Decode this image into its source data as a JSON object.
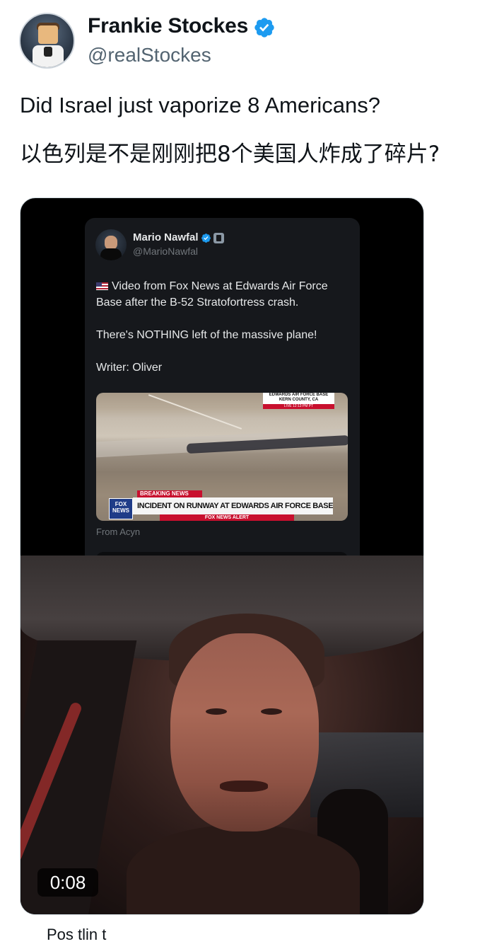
{
  "author": {
    "name": "Frankie Stockes",
    "handle": "@realStockes",
    "verified": true
  },
  "post": {
    "text_en": "Did Israel just vaporize 8 Americans?",
    "text_zh": "以色列是不是刚刚把8个美国人炸成了碎片?"
  },
  "embedded_post": {
    "name": "Mario Nawfal",
    "handle": "@MarioNawfal",
    "line1": "Video from Fox News at Edwards Air Force Base after the B-52 Stratofortress crash.",
    "line2": "There's NOTHING left of the massive plane!",
    "line3": "Writer: Oliver",
    "from": "From Acyn",
    "video": {
      "location": "EDWARDS AIR FORCE BASE",
      "county": "KERN COUNTY, CA",
      "live": "LIVE 12:13 PM PT",
      "breaking": "BREAKING NEWS",
      "headline": "INCIDENT ON RUNWAY AT EDWARDS AIR FORCE BASE IN CA",
      "alert": "FOX NEWS ALERT",
      "logo": "FOX NEWS"
    }
  },
  "video_timer": "0:08",
  "footer_partial": "Pos tlin t",
  "colors": {
    "verified_blue": "#1d9bf0",
    "fox_red": "#c8102e"
  }
}
